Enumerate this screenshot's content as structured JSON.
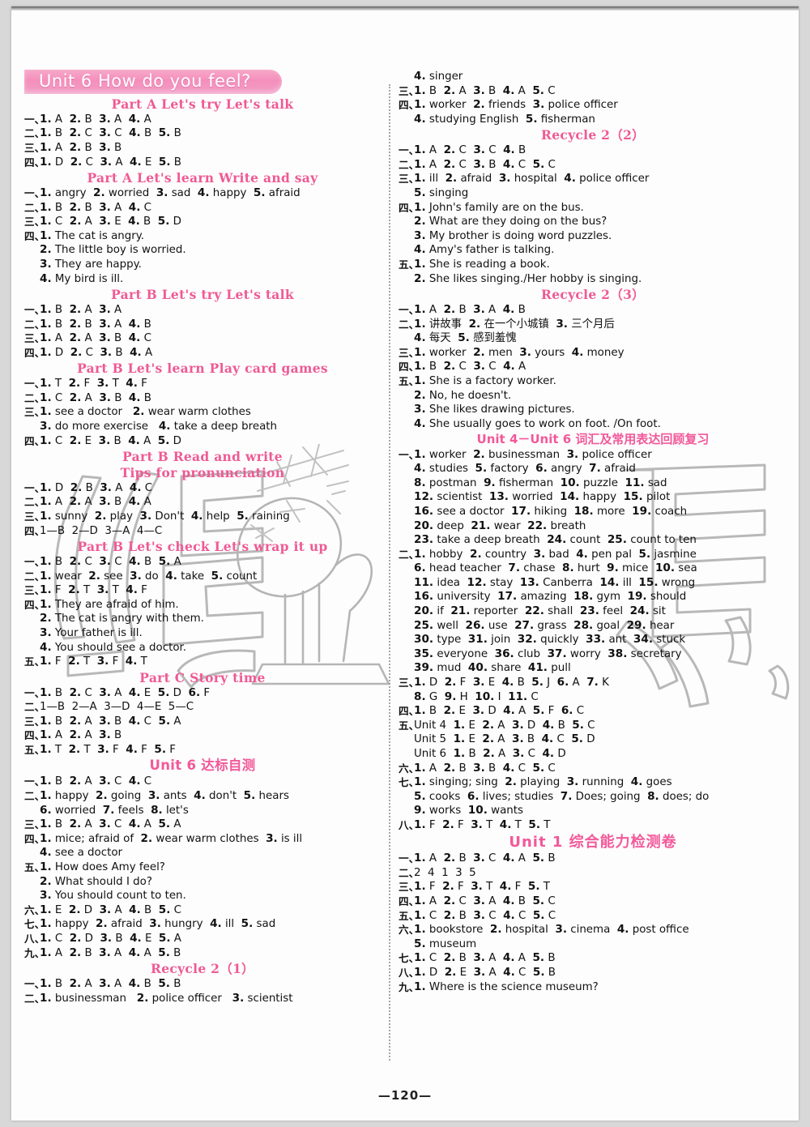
{
  "page": {
    "number": "—120—",
    "banner_title": "Unit 6   How do you feel?",
    "accent": "#ef5a94",
    "banner_bg": "#f48fbc"
  },
  "left_column": [
    {
      "type": "banner",
      "text": "Unit 6   How do you feel?"
    },
    {
      "type": "head",
      "text": "Part A   Let's try   Let's talk"
    },
    {
      "type": "row",
      "mark": "一、",
      "text": "1. A  2. B  3. A  4. A"
    },
    {
      "type": "row",
      "mark": "二、",
      "text": "1. B  2. C  3. C  4. B  5. B"
    },
    {
      "type": "row",
      "mark": "三、",
      "text": "1. A  2. B  3. B"
    },
    {
      "type": "row",
      "mark": "四、",
      "text": "1. D  2. C  3. A  4. E  5. B"
    },
    {
      "type": "head",
      "text": "Part A   Let's learn   Write and say"
    },
    {
      "type": "row",
      "mark": "一、",
      "text": "1. angry  2. worried  3. sad  4. happy  5. afraid"
    },
    {
      "type": "row",
      "mark": "二、",
      "text": "1. B  2. B  3. A  4. C"
    },
    {
      "type": "row",
      "mark": "三、",
      "text": "1. C  2. A  3. E  4. B  5. D"
    },
    {
      "type": "row",
      "mark": "四、",
      "text": "1. The cat is angry."
    },
    {
      "type": "row",
      "mark": "",
      "text": "2. The little boy is worried."
    },
    {
      "type": "row",
      "mark": "",
      "text": "3. They are happy."
    },
    {
      "type": "row",
      "mark": "",
      "text": "4. My bird is ill."
    },
    {
      "type": "head",
      "text": "Part B   Let's try   Let's talk"
    },
    {
      "type": "row",
      "mark": "一、",
      "text": "1. B  2. A  3. A"
    },
    {
      "type": "row",
      "mark": "二、",
      "text": "1. B  2. B  3. A  4. B"
    },
    {
      "type": "row",
      "mark": "三、",
      "text": "1. A  2. A  3. B  4. C"
    },
    {
      "type": "row",
      "mark": "四、",
      "text": "1. D  2. C  3. B  4. A"
    },
    {
      "type": "head",
      "text": "Part B   Let's learn   Play card games"
    },
    {
      "type": "row",
      "mark": "一、",
      "text": "1. T  2. F  3. T  4. F"
    },
    {
      "type": "row",
      "mark": "二、",
      "text": "1. C  2. A  3. B  4. B"
    },
    {
      "type": "row",
      "mark": "三、",
      "text": "1. see a doctor   2. wear warm clothes"
    },
    {
      "type": "row",
      "mark": "",
      "text": "3. do more exercise   4. take a deep breath"
    },
    {
      "type": "row",
      "mark": "四、",
      "text": "1. C  2. E  3. B  4. A  5. D"
    },
    {
      "type": "head",
      "text": "Part B   Read and write"
    },
    {
      "type": "head",
      "text": "Tips for pronunciation"
    },
    {
      "type": "row",
      "mark": "一、",
      "text": "1. D  2. B  3. A  4. C"
    },
    {
      "type": "row",
      "mark": "二、",
      "text": "1. A  2. A  3. B  4. A"
    },
    {
      "type": "row",
      "mark": "三、",
      "text": "1. sunny  2. play  3. Don't  4. help  5. raining"
    },
    {
      "type": "row",
      "mark": "四、",
      "text": "1—B  2—D  3—A  4—C"
    },
    {
      "type": "head",
      "text": "Part B   Let's check   Let's wrap it up"
    },
    {
      "type": "row",
      "mark": "一、",
      "text": "1. B  2. C  3. C  4. B  5. A"
    },
    {
      "type": "row",
      "mark": "二、",
      "text": "1. wear  2. see  3. do  4. take  5. count"
    },
    {
      "type": "row",
      "mark": "三、",
      "text": "1. F  2. T  3. T  4. F"
    },
    {
      "type": "row",
      "mark": "四、",
      "text": "1. They are afraid of him."
    },
    {
      "type": "row",
      "mark": "",
      "text": "2. The cat is angry with them."
    },
    {
      "type": "row",
      "mark": "",
      "text": "3. Your father is ill."
    },
    {
      "type": "row",
      "mark": "",
      "text": "4. You should see a doctor."
    },
    {
      "type": "row",
      "mark": "五、",
      "text": "1. F  2. T  3. F  4. T"
    },
    {
      "type": "head",
      "text": "Part C   Story time"
    },
    {
      "type": "row",
      "mark": "一、",
      "text": "1. B  2. C  3. A  4. E  5. D  6. F"
    },
    {
      "type": "row",
      "mark": "二、",
      "text": "1—B  2—A  3—D  4—E  5—C"
    },
    {
      "type": "row",
      "mark": "三、",
      "text": "1. B  2. A  3. B  4. C  5. A"
    },
    {
      "type": "row",
      "mark": "四、",
      "text": "1. A  2. A  3. B"
    },
    {
      "type": "row",
      "mark": "五、",
      "text": "1. T  2. T  3. F  4. F  5. F"
    },
    {
      "type": "head_cn",
      "text": "Unit 6 达标自测"
    },
    {
      "type": "row",
      "mark": "一、",
      "text": "1. B  2. A  3. C  4. C"
    },
    {
      "type": "row",
      "mark": "二、",
      "text": "1. happy  2. going  3. ants  4. don't  5. hears"
    },
    {
      "type": "row",
      "mark": "",
      "text": "6. worried  7. feels  8. let's"
    },
    {
      "type": "row",
      "mark": "三、",
      "text": "1. B  2. A  3. C  4. A  5. A"
    },
    {
      "type": "row",
      "mark": "四、",
      "text": "1. mice; afraid of  2. wear warm clothes  3. is ill"
    },
    {
      "type": "row",
      "mark": "",
      "text": "4. see a doctor"
    },
    {
      "type": "row",
      "mark": "五、",
      "text": "1. How does Amy feel?"
    },
    {
      "type": "row",
      "mark": "",
      "text": "2. What should I do?"
    },
    {
      "type": "row",
      "mark": "",
      "text": "3. You should count to ten."
    },
    {
      "type": "row",
      "mark": "六、",
      "text": "1. E  2. D  3. A  4. B  5. C"
    },
    {
      "type": "row",
      "mark": "七、",
      "text": "1. happy  2. afraid  3. hungry  4. ill  5. sad"
    },
    {
      "type": "row",
      "mark": "八、",
      "text": "1. C  2. D  3. B  4. E  5. A"
    },
    {
      "type": "row",
      "mark": "九、",
      "text": "1. A  2. B  3. A  4. A  5. B"
    },
    {
      "type": "head",
      "text": "Recycle 2（1）"
    },
    {
      "type": "row",
      "mark": "一、",
      "text": "1. B  2. A  3. A  4. B  5. B"
    },
    {
      "type": "row",
      "mark": "二、",
      "text": "1. businessman   2. police officer   3. scientist"
    }
  ],
  "right_column": [
    {
      "type": "row",
      "mark": "",
      "text": "4. singer"
    },
    {
      "type": "row",
      "mark": "三、",
      "text": "1. B  2. A  3. B  4. A  5. C"
    },
    {
      "type": "row",
      "mark": "四、",
      "text": "1. worker  2. friends  3. police officer"
    },
    {
      "type": "row",
      "mark": "",
      "text": "4. studying English  5. fisherman"
    },
    {
      "type": "head",
      "text": "Recycle 2（2）"
    },
    {
      "type": "row",
      "mark": "一、",
      "text": "1. A  2. C  3. C  4. B"
    },
    {
      "type": "row",
      "mark": "二、",
      "text": "1. A  2. C  3. B  4. C  5. C"
    },
    {
      "type": "row",
      "mark": "三、",
      "text": "1. ill  2. afraid  3. hospital  4. police officer"
    },
    {
      "type": "row",
      "mark": "",
      "text": "5. singing"
    },
    {
      "type": "row",
      "mark": "四、",
      "text": "1. John's family are on the bus."
    },
    {
      "type": "row",
      "mark": "",
      "text": "2. What are they doing on the bus?"
    },
    {
      "type": "row",
      "mark": "",
      "text": "3. My brother is doing word puzzles."
    },
    {
      "type": "row",
      "mark": "",
      "text": "4. Amy's father is talking."
    },
    {
      "type": "row",
      "mark": "五、",
      "text": "1. She is reading a book."
    },
    {
      "type": "row",
      "mark": "",
      "text": "2. She likes singing./Her hobby is singing."
    },
    {
      "type": "head",
      "text": "Recycle 2（3）"
    },
    {
      "type": "row",
      "mark": "一、",
      "text": "1. A  2. B  3. A  4. B"
    },
    {
      "type": "row",
      "mark": "二、",
      "text": "1. 讲故事  2. 在一个小城镇  3. 三个月后"
    },
    {
      "type": "row",
      "mark": "",
      "text": "4. 每天  5. 感到羞愧"
    },
    {
      "type": "row",
      "mark": "三、",
      "text": "1. worker  2. men  3. yours  4. money"
    },
    {
      "type": "row",
      "mark": "四、",
      "text": "1. B  2. C  3. C  4. A"
    },
    {
      "type": "row",
      "mark": "五、",
      "text": "1. She is a factory worker."
    },
    {
      "type": "row",
      "mark": "",
      "text": "2. No, he doesn't."
    },
    {
      "type": "row",
      "mark": "",
      "text": "3. She likes drawing pictures."
    },
    {
      "type": "row",
      "mark": "",
      "text": "4. She usually goes to work on foot. /On foot."
    },
    {
      "type": "head_cnwide",
      "text": "Unit 4－Unit 6 词汇及常用表达回顾复习"
    },
    {
      "type": "row",
      "mark": "一、",
      "text": "1. worker  2. businessman  3. police officer"
    },
    {
      "type": "row",
      "mark": "",
      "text": "4. studies  5. factory  6. angry  7. afraid"
    },
    {
      "type": "row",
      "mark": "",
      "text": "8. postman  9. fisherman  10. puzzle  11. sad"
    },
    {
      "type": "row",
      "mark": "",
      "text": "12. scientist  13. worried  14. happy  15. pilot"
    },
    {
      "type": "row",
      "mark": "",
      "text": "16. see a doctor  17. hiking  18. more  19. coach"
    },
    {
      "type": "row",
      "mark": "",
      "text": "20. deep  21. wear  22. breath"
    },
    {
      "type": "row",
      "mark": "",
      "text": "23. take a deep breath  24. count  25. count to ten"
    },
    {
      "type": "row",
      "mark": "二、",
      "text": "1. hobby  2. country  3. bad  4. pen pal  5. jasmine"
    },
    {
      "type": "row",
      "mark": "",
      "text": "6. head teacher  7. chase  8. hurt  9. mice  10. sea"
    },
    {
      "type": "row",
      "mark": "",
      "text": "11. idea  12. stay  13. Canberra  14. ill  15. wrong"
    },
    {
      "type": "row",
      "mark": "",
      "text": "16. university  17. amazing  18. gym  19. should"
    },
    {
      "type": "row",
      "mark": "",
      "text": "20. if  21. reporter  22. shall  23. feel  24. sit"
    },
    {
      "type": "row",
      "mark": "",
      "text": "25. well  26. use  27. grass  28. goal  29. hear"
    },
    {
      "type": "row",
      "mark": "",
      "text": "30. type  31. join  32. quickly  33. ant  34. stuck"
    },
    {
      "type": "row",
      "mark": "",
      "text": "35. everyone  36. club  37. worry  38. secretary"
    },
    {
      "type": "row",
      "mark": "",
      "text": "39. mud  40. share  41. pull"
    },
    {
      "type": "row",
      "mark": "三、",
      "text": "1. D  2. F  3. E  4. B  5. J  6. A  7. K"
    },
    {
      "type": "row",
      "mark": "",
      "text": "8. G  9. H  10. I  11. C"
    },
    {
      "type": "row",
      "mark": "四、",
      "text": "1. B  2. E  3. D  4. A  5. F  6. C"
    },
    {
      "type": "row",
      "mark": "五、",
      "text": "Unit 4  1. E  2. A  3. D  4. B  5. C"
    },
    {
      "type": "row",
      "mark": "",
      "text": "Unit 5  1. E  2. A  3. B  4. C  5. D"
    },
    {
      "type": "row",
      "mark": "",
      "text": "Unit 6  1. B  2. A  3. C  4. D"
    },
    {
      "type": "row",
      "mark": "六、",
      "text": "1. A  2. B  3. B  4. C  5. C"
    },
    {
      "type": "row",
      "mark": "七、",
      "text": "1. singing; sing  2. playing  3. running  4. goes"
    },
    {
      "type": "row",
      "mark": "",
      "text": "5. cooks  6. lives; studies  7. Does; going  8. does; do"
    },
    {
      "type": "row",
      "mark": "",
      "text": "9. works  10. wants"
    },
    {
      "type": "row",
      "mark": "八、",
      "text": "1. F  2. F  3. T  4. T  5. T"
    },
    {
      "type": "head_cnbig",
      "text": "Unit 1 综合能力检测卷"
    },
    {
      "type": "row",
      "mark": "一、",
      "text": "1. A  2. B  3. C  4. A  5. B"
    },
    {
      "type": "row",
      "mark": "二、",
      "text": "2  4  1  3  5"
    },
    {
      "type": "row",
      "mark": "三、",
      "text": "1. F  2. F  3. T  4. F  5. T"
    },
    {
      "type": "row",
      "mark": "四、",
      "text": "1. A  2. C  3. A  4. B  5. C"
    },
    {
      "type": "row",
      "mark": "五、",
      "text": "1. C  2. B  3. C  4. C  5. C"
    },
    {
      "type": "row",
      "mark": "六、",
      "text": "1. bookstore  2. hospital  3. cinema  4. post office"
    },
    {
      "type": "row",
      "mark": "",
      "text": "5. museum"
    },
    {
      "type": "row",
      "mark": "七、",
      "text": "1. C  2. B  3. A  4. A  5. B"
    },
    {
      "type": "row",
      "mark": "八、",
      "text": "1. D  2. E  3. A  4. C  5. B"
    },
    {
      "type": "row",
      "mark": "九、",
      "text": "1. Where is the science museum?"
    }
  ]
}
